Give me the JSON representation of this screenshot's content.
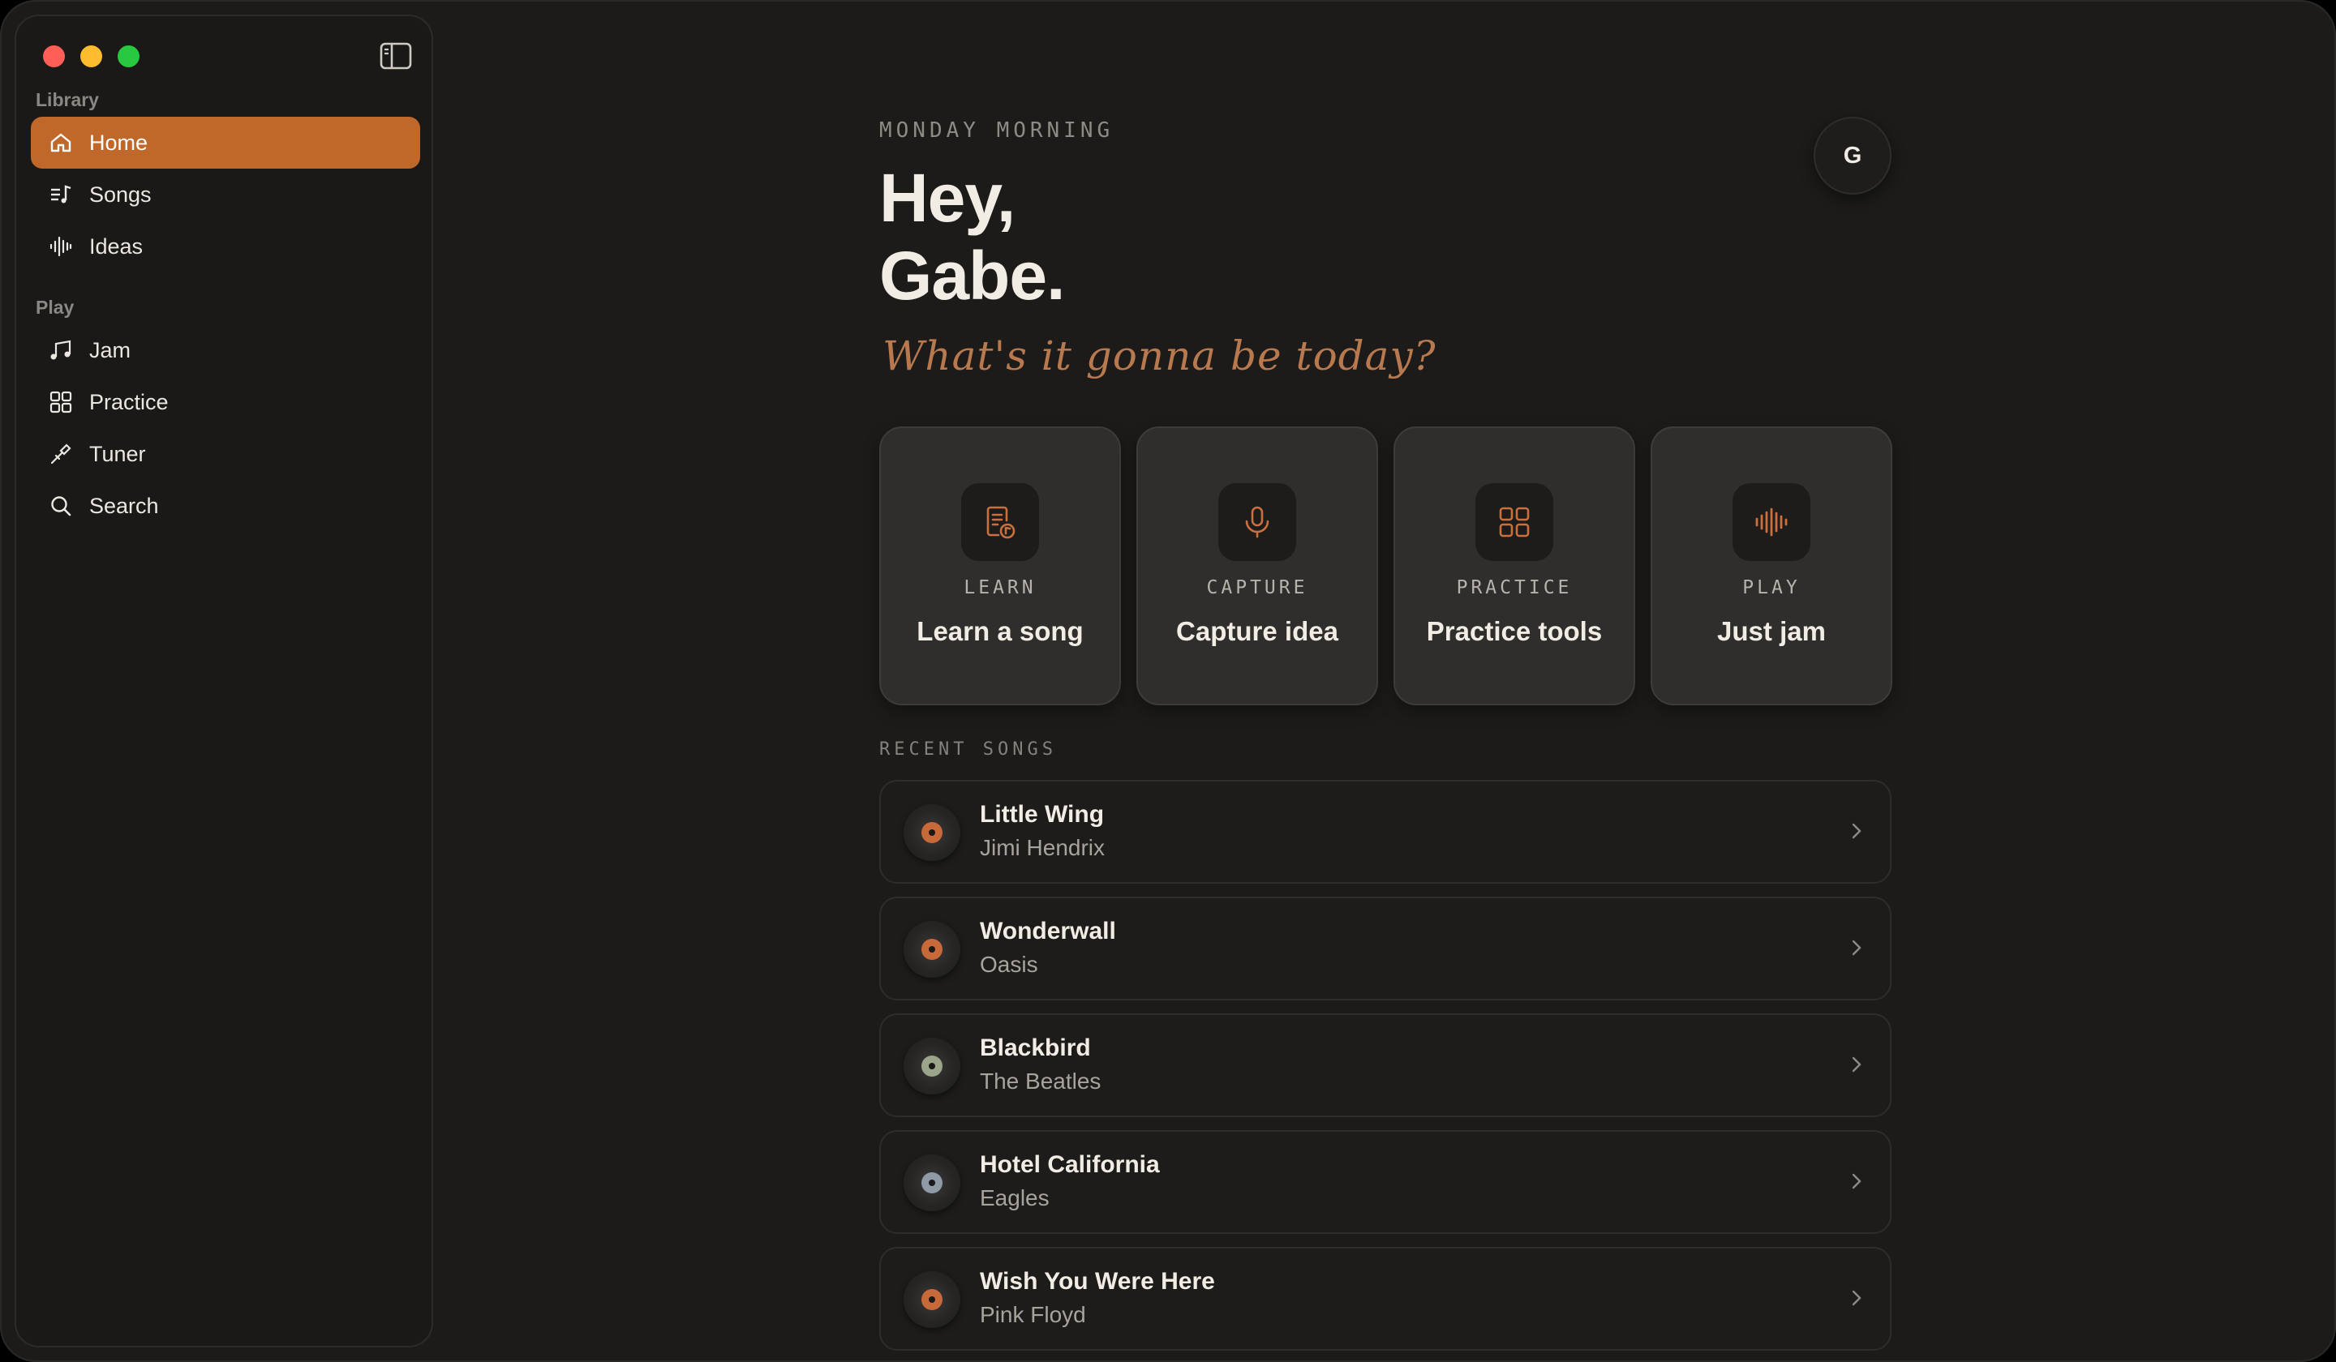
{
  "sidebar": {
    "sections": [
      {
        "label": "Library"
      },
      {
        "label": "Play"
      }
    ],
    "items": [
      {
        "label": "Home",
        "icon": "home-icon",
        "active": true
      },
      {
        "label": "Songs",
        "icon": "songs-icon"
      },
      {
        "label": "Ideas",
        "icon": "waveform-icon"
      },
      {
        "label": "Jam",
        "icon": "music-notes-icon"
      },
      {
        "label": "Practice",
        "icon": "grid-icon"
      },
      {
        "label": "Tuner",
        "icon": "tuner-icon"
      },
      {
        "label": "Search",
        "icon": "search-icon"
      }
    ]
  },
  "header": {
    "time_of_day": "MONDAY MORNING",
    "greeting_line1": "Hey,",
    "greeting_line2": "Gabe.",
    "tagline": "What's it gonna be today?",
    "avatar_initial": "G"
  },
  "actions": [
    {
      "kicker": "LEARN",
      "title": "Learn a song",
      "icon": "learn-song-icon"
    },
    {
      "kicker": "CAPTURE",
      "title": "Capture idea",
      "icon": "microphone-icon"
    },
    {
      "kicker": "PRACTICE",
      "title": "Practice tools",
      "icon": "grid-icon"
    },
    {
      "kicker": "PLAY",
      "title": "Just jam",
      "icon": "waveform-icon"
    }
  ],
  "recent": {
    "label": "RECENT SONGS",
    "songs": [
      {
        "title": "Little Wing",
        "artist": "Jimi Hendrix",
        "label_color": "#c8693a"
      },
      {
        "title": "Wonderwall",
        "artist": "Oasis",
        "label_color": "#c8693a"
      },
      {
        "title": "Blackbird",
        "artist": "The Beatles",
        "label_color": "#9aa58a"
      },
      {
        "title": "Hotel California",
        "artist": "Eagles",
        "label_color": "#8e9aa6"
      },
      {
        "title": "Wish You Were Here",
        "artist": "Pink Floyd",
        "label_color": "#c8693a"
      }
    ]
  },
  "colors": {
    "accent": "#c0672a",
    "accent_icon": "#c9703e",
    "background": "#1c1b1a"
  }
}
